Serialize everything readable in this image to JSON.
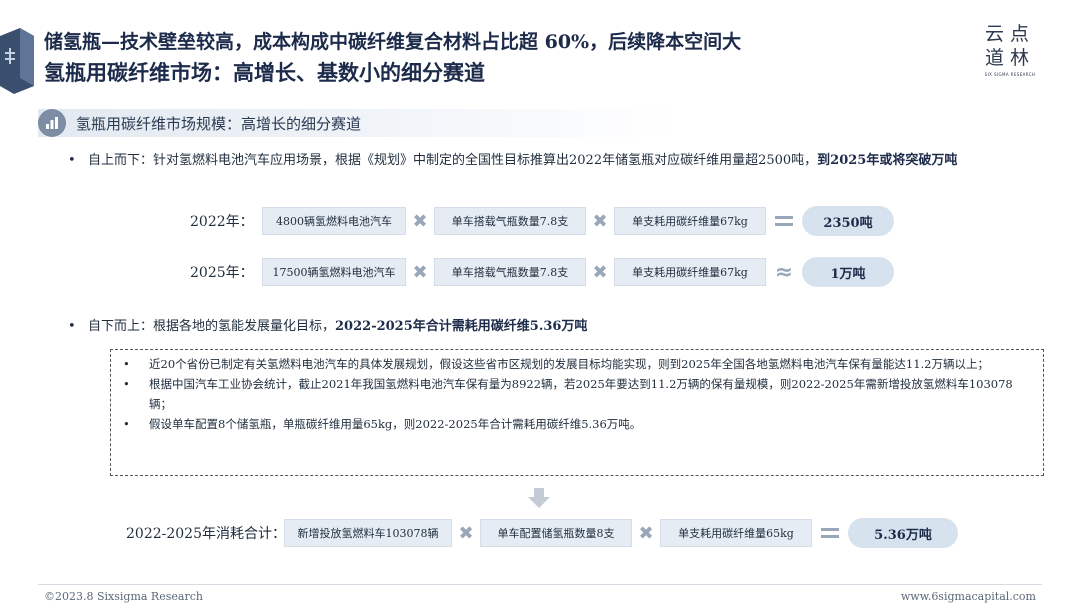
{
  "header": {
    "main_title": "储氢瓶—技术壁垒较高，成本构成中碳纤维复合材料占比超 60%，后续降本空间大",
    "sub_title": "氢瓶用碳纤维市场：高增长、基数小的细分赛道",
    "logo_line1": "云点",
    "logo_line2": "道林",
    "logo_sub": "SIX SIGMA RESEARCH"
  },
  "section": {
    "title": "氢瓶用碳纤维市场规模：高增长的细分赛道"
  },
  "top_down": {
    "bullet": "•",
    "text": "自上而下：针对氢燃料电池汽车应用场景，根据《规划》中制定的全国性目标推算出2022年储氢瓶对应碳纤维用量超2500吨，",
    "bold": "到2025年或将突破万吨",
    "row_2022": {
      "label": "2022年：",
      "box1": "4800辆氢燃料电池汽车",
      "box2": "单车搭载气瓶数量7.8支",
      "box3": "单支耗用碳纤维量67kg",
      "result": "2350吨"
    },
    "row_2025": {
      "label": "2025年：",
      "box1": "17500辆氢燃料电池汽车",
      "box2": "单车搭载气瓶数量7.8支",
      "box3": "单支耗用碳纤维量67kg",
      "result": "1万吨"
    }
  },
  "bottom_up": {
    "bullet": "•",
    "text": "自下而上：根据各地的氢能发展量化目标，",
    "bold": "2022-2025年合计需耗用碳纤维5.36万吨",
    "details": [
      "近20个省份已制定有关氢燃料电池汽车的具体发展规划，假设这些省市区规划的发展目标均能实现，则到2025年全国各地氢燃料电池汽车保有量能达11.2万辆以上；",
      "根据中国汽车工业协会统计，截止2021年我国氢燃料电池汽车保有量为8922辆，若2025年要达到11.2万辆的保有量规模，则2022-2025年需新增投放氢燃料车103078辆；",
      "假设单车配置8个储氢瓶，单瓶碳纤维用量65kg，则2022-2025年合计需耗用碳纤维5.36万吨。"
    ],
    "total": {
      "label": "2022-2025年消耗合计：",
      "box1": "新增投放氢燃料车103078辆",
      "box2": "单车配置储氢瓶数量8支",
      "box3": "单支耗用碳纤维量65kg",
      "result": "5.36万吨"
    }
  },
  "symbols": {
    "multiply": "✖",
    "approx": "≈"
  },
  "footer": {
    "left": "©2023.8 Sixsigma Research",
    "right": "www.6sigmacapital.com"
  },
  "colors": {
    "title": "#1d2b4b",
    "box": "#e6ecf3",
    "result": "#d6e2ee",
    "icon": "#7d8da4"
  }
}
